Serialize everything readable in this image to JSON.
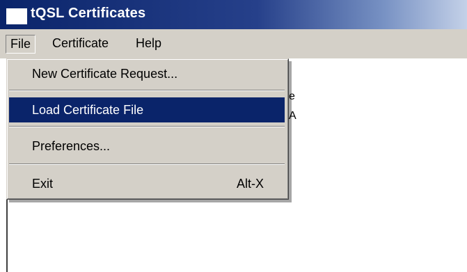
{
  "window": {
    "title": "tQSL Certificates"
  },
  "menubar": {
    "items": [
      {
        "label": "File"
      },
      {
        "label": "Certificate"
      },
      {
        "label": "Help"
      }
    ]
  },
  "file_menu": {
    "items": [
      {
        "label": "New Certificate Request...",
        "shortcut": ""
      },
      {
        "label": "Load Certificate File",
        "shortcut": "",
        "selected": true
      },
      {
        "label": "Preferences...",
        "shortcut": ""
      },
      {
        "label": "Exit",
        "shortcut": "Alt-X"
      }
    ]
  },
  "background_text": {
    "line1_fragment": "e",
    "line2_fragment": "A"
  },
  "colors": {
    "titlebar_start": "#0a246a",
    "titlebar_end": "#c4d1e8",
    "menu_bg": "#d4d0c8",
    "highlight": "#0a246a"
  }
}
